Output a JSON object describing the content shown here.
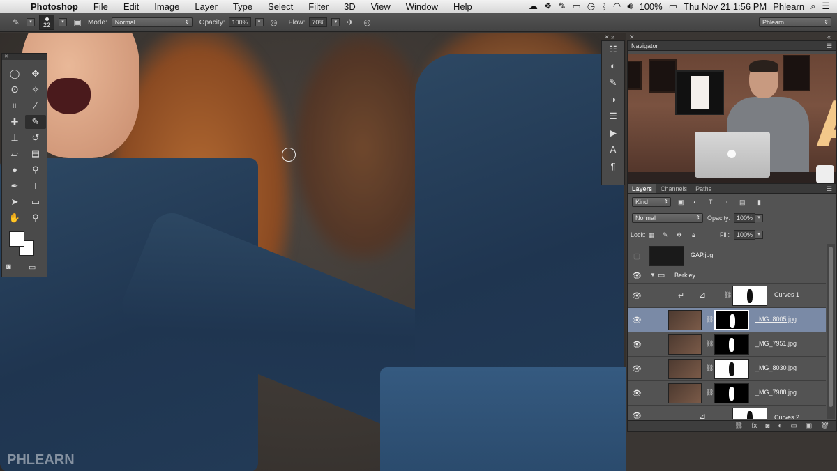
{
  "menubar": {
    "app": "Photoshop",
    "items": [
      "File",
      "Edit",
      "Image",
      "Layer",
      "Type",
      "Select",
      "Filter",
      "3D",
      "View",
      "Window",
      "Help"
    ],
    "battery": "100%",
    "datetime": "Thu Nov 21  1:56 PM",
    "user": "Phlearn"
  },
  "options_bar": {
    "brush_size": "22",
    "mode_label": "Mode:",
    "mode_value": "Normal",
    "opacity_label": "Opacity:",
    "opacity_value": "100%",
    "flow_label": "Flow:",
    "flow_value": "70%",
    "workspace": "Phlearn"
  },
  "navigator": {
    "title": "Navigator"
  },
  "layers_panel": {
    "tabs": [
      "Layers",
      "Channels",
      "Paths"
    ],
    "filter_kind": "Kind",
    "blend_mode": "Normal",
    "opacity_label": "Opacity:",
    "opacity_value": "100%",
    "lock_label": "Lock:",
    "fill_label": "Fill:",
    "fill_value": "100%",
    "layers": [
      {
        "name": "GAP.jpg"
      },
      {
        "name": "Berkley"
      },
      {
        "name": "Curves 1"
      },
      {
        "name": "_MG_8005.jpg"
      },
      {
        "name": "_MG_7951.jpg"
      },
      {
        "name": "_MG_8030.jpg"
      },
      {
        "name": "_MG_7988.jpg"
      },
      {
        "name": "Curves 2"
      }
    ]
  },
  "canvas": {
    "watermark": "PHLEARN"
  },
  "colors": {
    "menubar": "#e4e4e4",
    "panel": "#535353",
    "selected_layer": "#7a8aa6",
    "canvas_bg": "#3b3632"
  }
}
